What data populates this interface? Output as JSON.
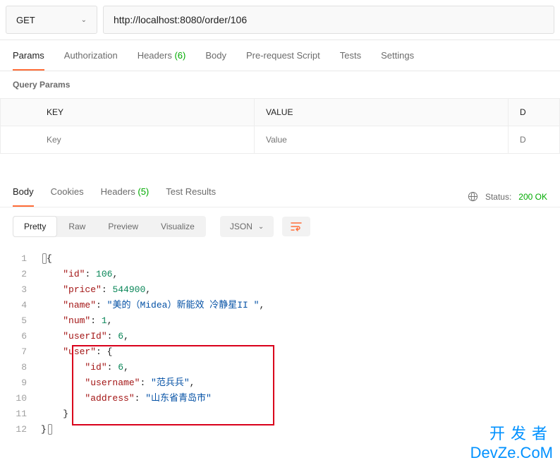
{
  "request": {
    "method": "GET",
    "url": "http://localhost:8080/order/106"
  },
  "tabs": {
    "params": "Params",
    "authorization": "Authorization",
    "headers_label": "Headers",
    "headers_count": "(6)",
    "body": "Body",
    "prerequest": "Pre-request Script",
    "tests": "Tests",
    "settings": "Settings"
  },
  "query": {
    "title": "Query Params",
    "col_key": "KEY",
    "col_value": "VALUE",
    "col_desc": "D",
    "placeholder_key": "Key",
    "placeholder_value": "Value",
    "placeholder_desc": "D"
  },
  "response": {
    "tabs": {
      "body": "Body",
      "cookies": "Cookies",
      "headers_label": "Headers",
      "headers_count": "(5)",
      "test_results": "Test Results"
    },
    "status_label": "Status:",
    "status_value": "200 OK",
    "views": {
      "pretty": "Pretty",
      "raw": "Raw",
      "preview": "Preview",
      "visualize": "Visualize"
    },
    "format": "JSON"
  },
  "json_body": {
    "id": 106,
    "price": 544900,
    "name": "美的（Midea）新能效 冷静星II ",
    "num": 1,
    "userId": 6,
    "user": {
      "id": 6,
      "username": "范兵兵",
      "address": "山东省青岛市"
    }
  },
  "code_lines": [
    {
      "ln": 1,
      "tokens": [
        {
          "t": "{",
          "c": "punc"
        }
      ]
    },
    {
      "ln": 2,
      "tokens": [
        {
          "t": "    ",
          "c": "plain"
        },
        {
          "t": "\"id\"",
          "c": "key"
        },
        {
          "t": ": ",
          "c": "punc"
        },
        {
          "t": "106",
          "c": "num"
        },
        {
          "t": ",",
          "c": "punc"
        }
      ]
    },
    {
      "ln": 3,
      "tokens": [
        {
          "t": "    ",
          "c": "plain"
        },
        {
          "t": "\"price\"",
          "c": "key"
        },
        {
          "t": ": ",
          "c": "punc"
        },
        {
          "t": "544900",
          "c": "num"
        },
        {
          "t": ",",
          "c": "punc"
        }
      ]
    },
    {
      "ln": 4,
      "tokens": [
        {
          "t": "    ",
          "c": "plain"
        },
        {
          "t": "\"name\"",
          "c": "key"
        },
        {
          "t": ": ",
          "c": "punc"
        },
        {
          "t": "\"美的（Midea）新能效 冷静星II \"",
          "c": "str"
        },
        {
          "t": ",",
          "c": "punc"
        }
      ]
    },
    {
      "ln": 5,
      "tokens": [
        {
          "t": "    ",
          "c": "plain"
        },
        {
          "t": "\"num\"",
          "c": "key"
        },
        {
          "t": ": ",
          "c": "punc"
        },
        {
          "t": "1",
          "c": "num"
        },
        {
          "t": ",",
          "c": "punc"
        }
      ]
    },
    {
      "ln": 6,
      "tokens": [
        {
          "t": "    ",
          "c": "plain"
        },
        {
          "t": "\"userId\"",
          "c": "key"
        },
        {
          "t": ": ",
          "c": "punc"
        },
        {
          "t": "6",
          "c": "num"
        },
        {
          "t": ",",
          "c": "punc"
        }
      ]
    },
    {
      "ln": 7,
      "tokens": [
        {
          "t": "    ",
          "c": "plain"
        },
        {
          "t": "\"user\"",
          "c": "key"
        },
        {
          "t": ": ",
          "c": "punc"
        },
        {
          "t": "{",
          "c": "punc"
        }
      ]
    },
    {
      "ln": 8,
      "tokens": [
        {
          "t": "        ",
          "c": "plain"
        },
        {
          "t": "\"id\"",
          "c": "key"
        },
        {
          "t": ": ",
          "c": "punc"
        },
        {
          "t": "6",
          "c": "num"
        },
        {
          "t": ",",
          "c": "punc"
        }
      ]
    },
    {
      "ln": 9,
      "tokens": [
        {
          "t": "        ",
          "c": "plain"
        },
        {
          "t": "\"username\"",
          "c": "key"
        },
        {
          "t": ": ",
          "c": "punc"
        },
        {
          "t": "\"范兵兵\"",
          "c": "str"
        },
        {
          "t": ",",
          "c": "punc"
        }
      ]
    },
    {
      "ln": 10,
      "tokens": [
        {
          "t": "        ",
          "c": "plain"
        },
        {
          "t": "\"address\"",
          "c": "key"
        },
        {
          "t": ": ",
          "c": "punc"
        },
        {
          "t": "\"山东省青岛市\"",
          "c": "str"
        }
      ]
    },
    {
      "ln": 11,
      "tokens": [
        {
          "t": "    ",
          "c": "plain"
        },
        {
          "t": "}",
          "c": "punc"
        }
      ]
    },
    {
      "ln": 12,
      "tokens": [
        {
          "t": "}",
          "c": "punc"
        }
      ]
    }
  ],
  "watermark": {
    "line1": "开发者",
    "line2": "DevZe.CoM"
  }
}
